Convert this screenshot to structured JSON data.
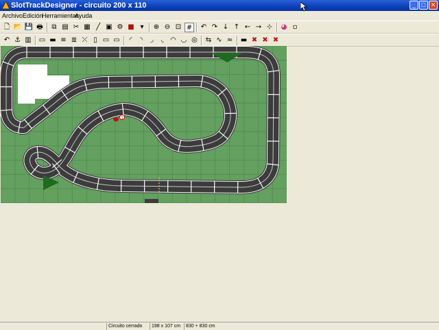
{
  "window": {
    "title": "SlotTrackDesigner - circuito 200 x 110"
  },
  "window_controls": {
    "minimize": "_",
    "maximize": "□",
    "close": "✕"
  },
  "menu": [
    "Archivo",
    "Edición",
    "Herramientas",
    "Ayuda"
  ],
  "toolbar1_icons": [
    "new-file-icon",
    "open-folder-icon",
    "save-icon",
    "print-icon",
    "copy-icon",
    "page-setup-icon",
    "tools-icon",
    "document-icon",
    "ruler-icon",
    "pieces-icon",
    "properties-icon",
    "color-icon",
    "color-dropdown-icon",
    "zoom-in-icon",
    "zoom-out-icon",
    "zoom-fit-icon",
    "grid-icon",
    "rotate-left-icon",
    "rotate-right-icon",
    "move-down-icon",
    "move-up-icon",
    "move-left-icon",
    "move-right-icon",
    "move-center-icon",
    "paint-icon",
    "clear-icon"
  ],
  "toolbar2_icons": [
    "undo-icon",
    "magnet-icon",
    "track-piece-icon",
    "straight-1-icon",
    "straight-2-icon",
    "straight-3-icon",
    "straight-4-icon",
    "crossing-icon",
    "straight-5-icon",
    "straight-6-icon",
    "straight-7-icon",
    "curve-1-icon",
    "curve-2-icon",
    "curve-3-icon",
    "curve-4-icon",
    "curve-5-icon",
    "curve-6-icon",
    "loop-icon",
    "fork-icon",
    "chicane-1-icon",
    "chicane-2-icon",
    "border-icon",
    "delete-1-icon",
    "delete-2-icon",
    "delete-3-icon"
  ],
  "car": {
    "number": "1"
  },
  "status": {
    "pane1": "",
    "pane2": "Circuito cerrado",
    "pane3": "198 x 107 cm",
    "pane4": "830 + 830 cm"
  },
  "colors": {
    "grass": "#64a060",
    "grass_grid": "#4f8a4d",
    "track": "#3c3c3c",
    "track_edge": "#ffffff",
    "title_bar": "#0a3fb8",
    "background": "#ece9d8",
    "car": "#c01010"
  }
}
